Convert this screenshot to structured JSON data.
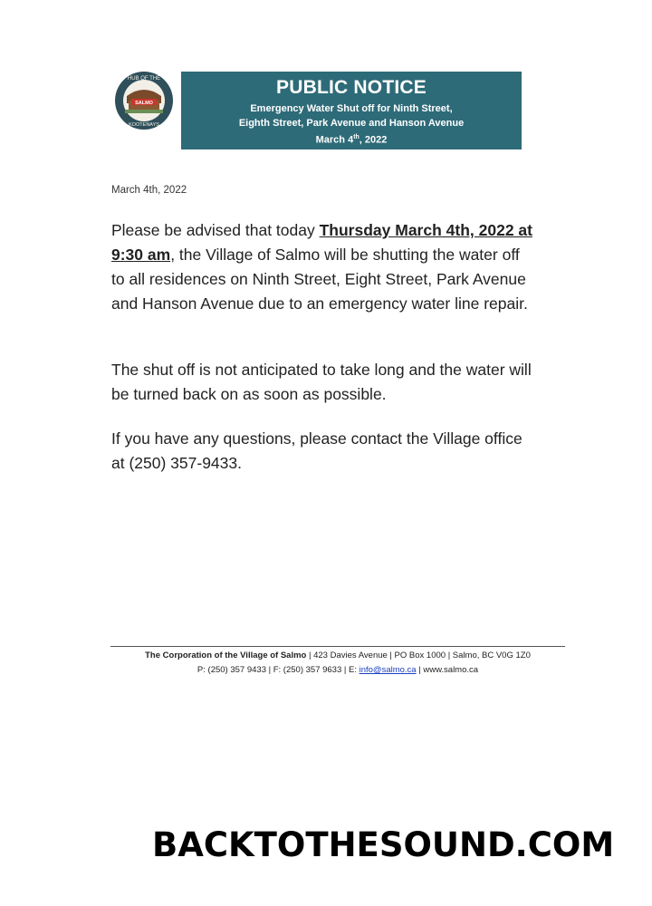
{
  "logo": {
    "top_text": "HUB OF THE",
    "center_text": "SALMO",
    "bottom_text": "KOOTENAYS"
  },
  "banner": {
    "title": "PUBLIC NOTICE",
    "line1": "Emergency Water Shut off for Ninth Street,",
    "line2": "Eighth Street, Park Avenue and Hanson Avenue",
    "date_prefix": "March 4",
    "date_sup": "th",
    "date_suffix": ", 2022",
    "color": "#2e6b78"
  },
  "date": "March 4th, 2022",
  "body": {
    "p1_lead": "Please be advised that today ",
    "p1_bold": "Thursday March 4th, 2022 at 9:30 am",
    "p1_rest": ", the Village of Salmo will be shutting the water off to all residences on Ninth Street, Eight Street, Park Avenue and Hanson Avenue due to an emergency water line repair.",
    "p2": "The shut off is not anticipated to take long and the water will be turned back on as soon as possible.",
    "p3": "If you have any questions, please contact the Village office at (250) 357-9433."
  },
  "footer": {
    "org": "The Corporation of the Village of Salmo",
    "address": " | 423 Davies Avenue | PO Box 1000 | Salmo, BC V0G 1Z0",
    "contact": "P: (250) 357 9433 | F: (250) 357 9633 | E: ",
    "email": "info@salmo.ca",
    "website": "| www.salmo.ca"
  },
  "watermark": "BACKTOTHESOUND.COM"
}
